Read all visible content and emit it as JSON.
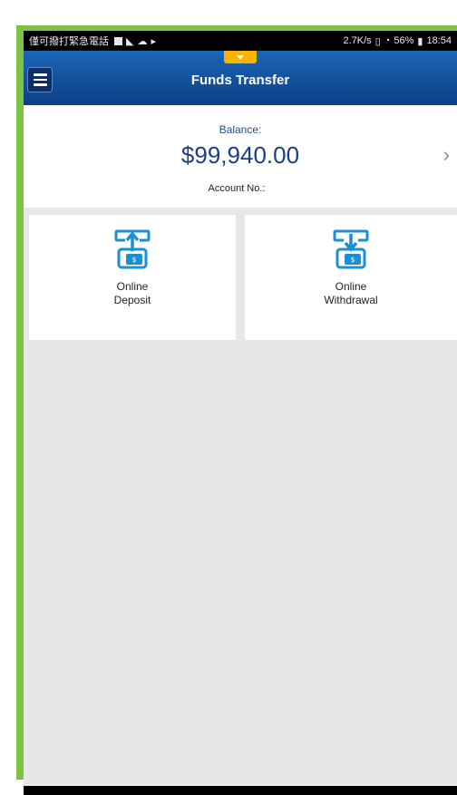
{
  "status_bar": {
    "carrier": "僅可撥打緊急電話",
    "right": "2.7K/s",
    "battery": "56%",
    "time": "18:54"
  },
  "header": {
    "title": "Funds Transfer"
  },
  "balance": {
    "label": "Balance:",
    "amount": "$99,940.00",
    "account_label": "Account No.:"
  },
  "actions": [
    {
      "line1": "Online",
      "line2": "Deposit",
      "icon": "deposit-icon"
    },
    {
      "line1": "Online",
      "line2": "Withdrawal",
      "icon": "withdrawal-icon"
    }
  ],
  "colors": {
    "header_blue": "#0d3f86",
    "accent_yellow": "#f7b500",
    "icon_blue": "#1a8fd6",
    "frame_green": "#7dc242"
  }
}
